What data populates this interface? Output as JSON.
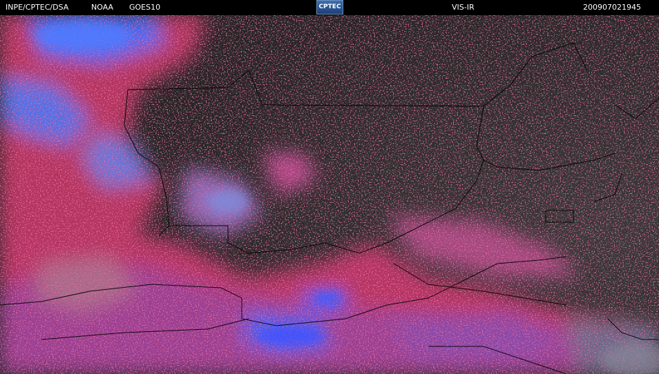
{
  "header": {
    "source": "INPE/CPTEC/DSA",
    "agency": "NOAA",
    "satellite": "GOES10",
    "logo_text": "CPTEC",
    "channel": "VIS-IR",
    "timestamp": "200907021945"
  },
  "colors": {
    "background": "#000000",
    "land_dark": "#2a2a2a",
    "cloud_low": "#c03060",
    "cloud_mid": "#9a4aa0",
    "cloud_high": "#4a6cf0",
    "border_lines": "#000000"
  }
}
